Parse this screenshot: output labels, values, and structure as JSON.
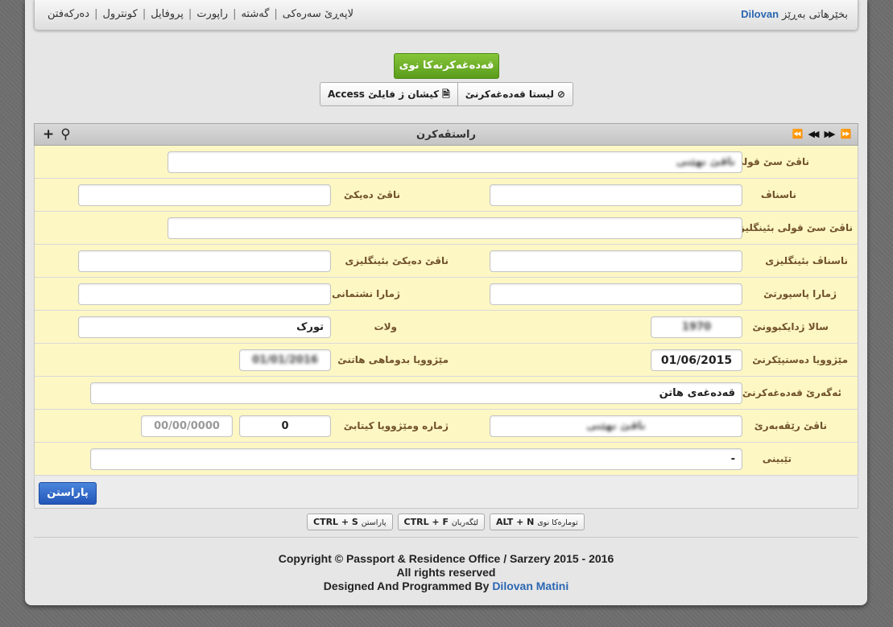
{
  "navbar": {
    "welcome": "بخێرهاتی بەڕێز",
    "user_name": "Dilovan",
    "links": [
      "لاپەڕێ سەرەکی",
      "گەشتە",
      "راپورت",
      "پروفایل",
      "کونترول",
      "دەرکەفتن"
    ]
  },
  "actions": {
    "new_button": "قەدەغەکرنەکا نوی",
    "list_button": "لیستا قەدەغەکرنێ",
    "access_button": "کیشان ژ فایلێ Access"
  },
  "grid": {
    "title": "راستڤەکرن",
    "pager_icons": [
      "first-icon",
      "prev-icon",
      "next-icon",
      "last-icon"
    ]
  },
  "form": {
    "full_name": {
      "label": "ناڤێ سێ قولی",
      "value": "ناڤێ نهێنی"
    },
    "nickname": {
      "label": "ناسناڤ",
      "value": ""
    },
    "mother_name": {
      "label": "ناڤێ دەیکێ",
      "value": ""
    },
    "full_name_en": {
      "label": "ناڤێ سێ قولی بئینگلیزی",
      "value": ""
    },
    "nickname_en": {
      "label": "ناسناڤ بئینگلیزی",
      "value": ""
    },
    "mother_name_en": {
      "label": "ناڤێ دەیکێ بئینگلیزی",
      "value": ""
    },
    "passport_no": {
      "label": "ژمارا پاسپورتێ",
      "value": ""
    },
    "id_no": {
      "label": "ژمارا نشتمانی",
      "value": ""
    },
    "birth_year": {
      "label": "سالا ژدایکبوونێ",
      "value": "1970"
    },
    "country": {
      "label": "ولات",
      "value": "تورک"
    },
    "start_date": {
      "label": "مێژوویا دەستپێکرنێ",
      "value": "01/06/2015"
    },
    "end_date": {
      "label": "مێژوویا بدوماهی هاتنێ",
      "value": "01/01/2016"
    },
    "ban_reason": {
      "label": "ئەگەرێ قەدەغەکرنێ",
      "value": "قەدەغەی هاتن"
    },
    "sender": {
      "label": "ناڤێ رێڤەبەرێ",
      "value": "ناڤێ نهێنی"
    },
    "letter": {
      "label": "ژمارە ومێژوویا کیتابێ",
      "number": "0",
      "date_placeholder": "00/00/0000"
    },
    "notes": {
      "label": "تێبینی",
      "value": "-"
    }
  },
  "save": {
    "label": "پاراستن"
  },
  "shortcuts": [
    {
      "keys": "ALT + N",
      "desc": "تومارەکا نوی"
    },
    {
      "keys": "CTRL + F",
      "desc": "لێگەریان"
    },
    {
      "keys": "CTRL + S",
      "desc": "پاراستن"
    }
  ],
  "footer": {
    "line1": "Copyright © Passport & Residence Office / Sarzery 2015 - 2016",
    "line2": "All rights reserved",
    "line3_prefix": "Designed And Programmed By",
    "author": "Dilovan Matini"
  }
}
